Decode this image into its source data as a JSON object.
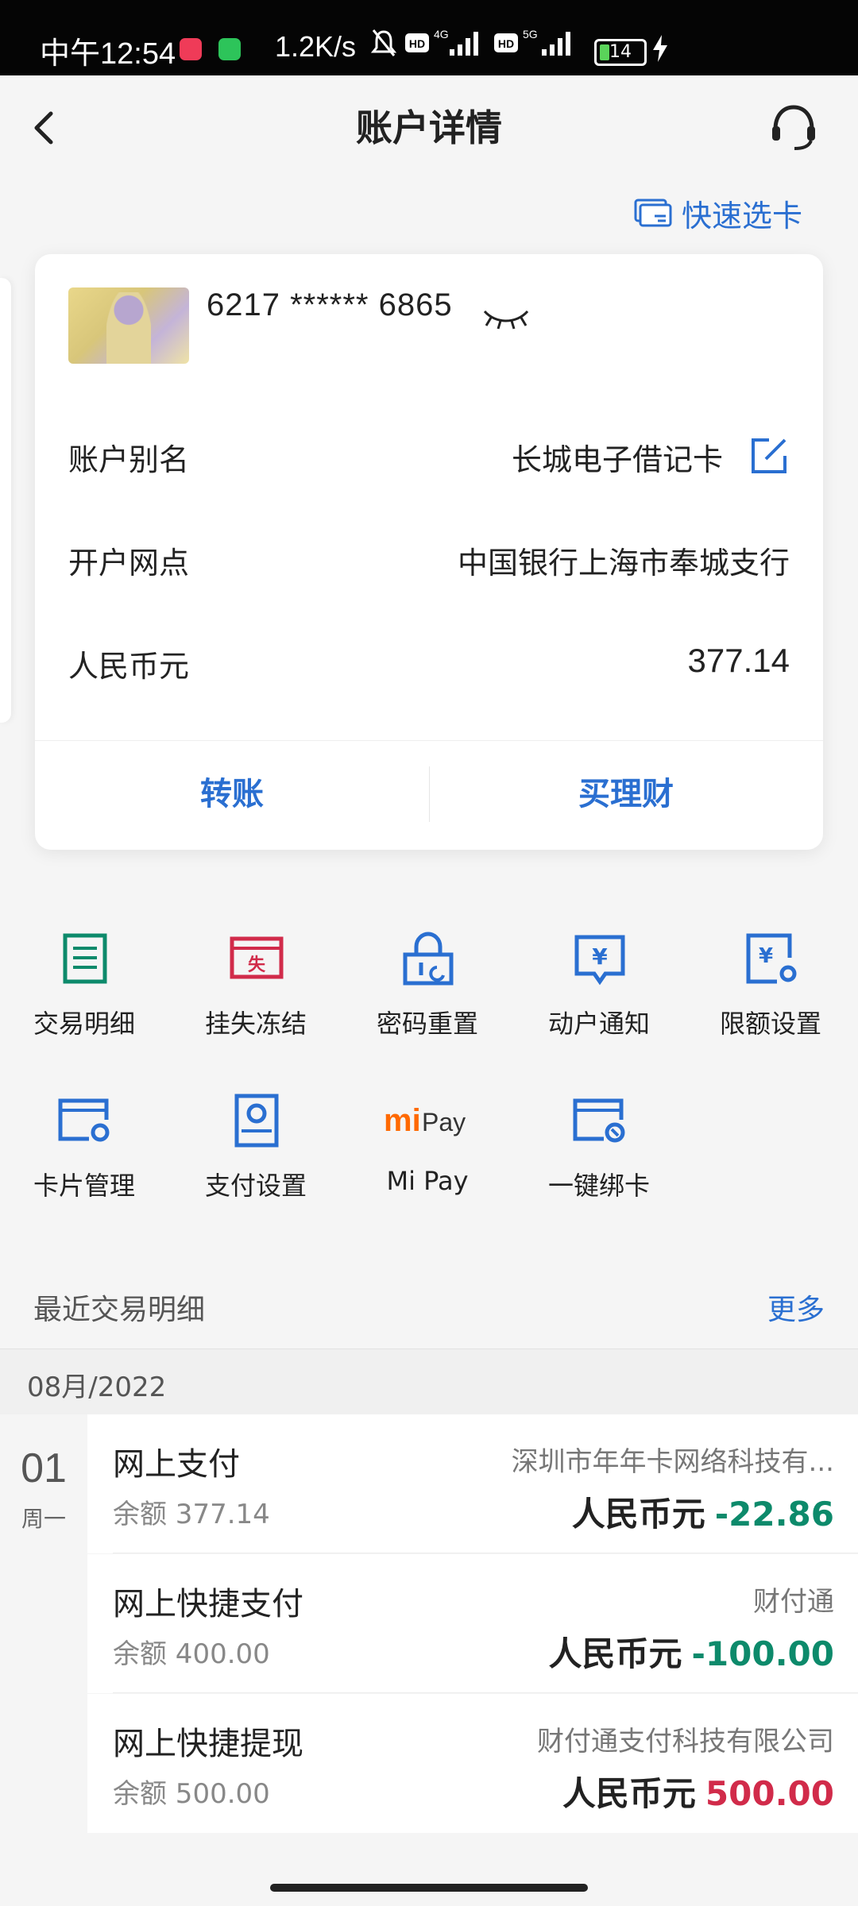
{
  "status_bar": {
    "time": "中午12:54",
    "net_speed": "1.2K/s",
    "signal1_label": "4G",
    "signal2_label": "5G",
    "battery": "14"
  },
  "header": {
    "title": "账户详情"
  },
  "quick_select_label": "快速选卡",
  "card": {
    "number": "6217 ****** 6865",
    "alias_label": "账户别名",
    "alias_value": "长城电子借记卡",
    "branch_label": "开户网点",
    "branch_value": "中国银行上海市奉城支行",
    "currency_label": "人民币元",
    "balance": "377.14",
    "actions": [
      "转账",
      "买理财"
    ]
  },
  "services": [
    {
      "label": "交易明细",
      "icon": "ledger-icon",
      "color": "#0d8a6b"
    },
    {
      "label": "挂失冻结",
      "icon": "lost-report-icon",
      "color": "#d12b4a"
    },
    {
      "label": "密码重置",
      "icon": "lock-reset-icon",
      "color": "#2a6fd1"
    },
    {
      "label": "动户通知",
      "icon": "yen-notice-icon",
      "color": "#2a6fd1"
    },
    {
      "label": "限额设置",
      "icon": "yen-settings-icon",
      "color": "#2a6fd1"
    },
    {
      "label": "卡片管理",
      "icon": "card-settings-icon",
      "color": "#2a6fd1"
    },
    {
      "label": "支付设置",
      "icon": "payment-settings-icon",
      "color": "#2a6fd1"
    },
    {
      "label": "Mi Pay",
      "icon": "mi-pay-icon",
      "color": "#ff6900"
    },
    {
      "label": "一键绑卡",
      "icon": "bind-card-icon",
      "color": "#2a6fd1"
    }
  ],
  "mi_pay_logo": {
    "mi": "mi",
    "pay": "Pay"
  },
  "recent": {
    "title": "最近交易明细",
    "more": "更多",
    "month": "08月/2022",
    "day": "01",
    "weekday": "周一",
    "transactions": [
      {
        "name": "网上支付",
        "balance": "余额 377.14",
        "counterparty": "深圳市年年卡网络科技有...",
        "currency": "人民币元",
        "amount": "-22.86",
        "sign": "neg"
      },
      {
        "name": "网上快捷支付",
        "balance": "余额 400.00",
        "counterparty": "财付通",
        "currency": "人民币元",
        "amount": "-100.00",
        "sign": "neg"
      },
      {
        "name": "网上快捷提现",
        "balance": "余额 500.00",
        "counterparty": "财付通支付科技有限公司",
        "currency": "人民币元",
        "amount": "500.00",
        "sign": "pos"
      }
    ]
  }
}
